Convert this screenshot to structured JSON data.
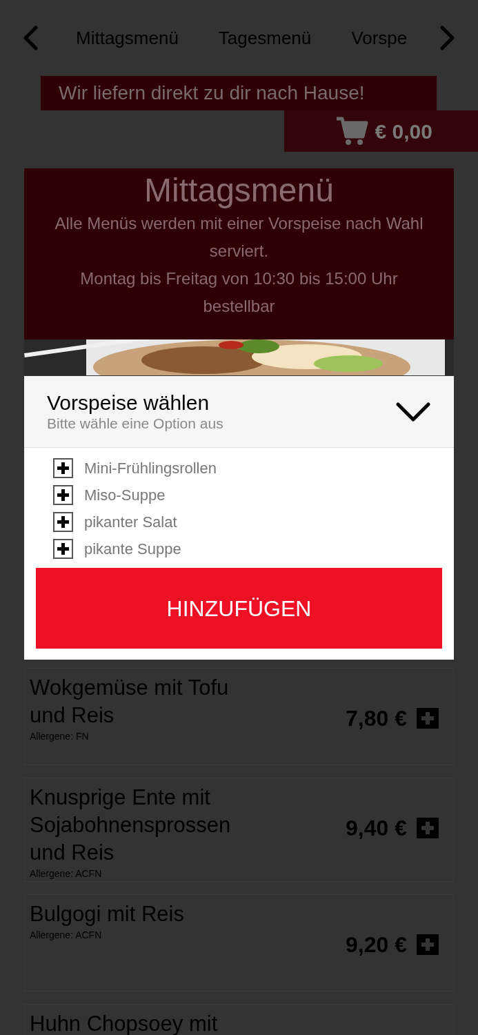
{
  "nav": {
    "tabs": [
      "Mittagsmenü",
      "Tagesmenü",
      "Vorspe"
    ]
  },
  "banner": {
    "text": "Wir liefern direkt zu dir nach Hause!"
  },
  "cart": {
    "total": "€ 0,00"
  },
  "section": {
    "title": "Mittagsmenü",
    "description": [
      "Alle Menüs werden mit einer Vorspeise nach Wahl serviert.",
      "Montag bis Freitag von 10:30 bis 15:00 Uhr bestellbar"
    ]
  },
  "dishes": [
    {
      "name": "Wokgemüse mit Tofu und Reis",
      "allergens": "Allergene: FN",
      "price": "7,80 €"
    },
    {
      "name": "Knusprige Ente mit Sojabohnensprossen und Reis",
      "allergens": "Allergene: ACFN",
      "price": "9,40 €"
    },
    {
      "name": "Bulgogi mit Reis",
      "allergens": "Allergene: ACFN",
      "price": "9,20 €"
    },
    {
      "name": "Huhn Chopsoey mit"
    }
  ],
  "modal": {
    "title": "Vorspeise wählen",
    "subtitle": "Bitte wähle eine Option aus",
    "options": [
      "Mini-Frühlingsrollen",
      "Miso-Suppe",
      "pikanter Salat",
      "pikante Suppe"
    ],
    "button": "HINZUFÜGEN"
  }
}
